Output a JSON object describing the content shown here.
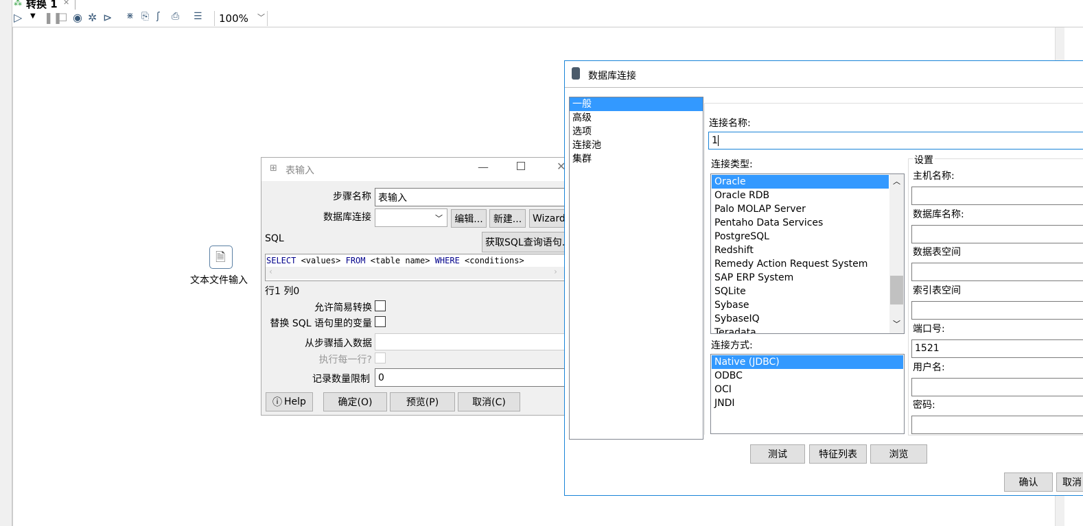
{
  "tab": {
    "title": "转换 1",
    "close": "✕"
  },
  "toolbar": {
    "icons": [
      "run-icon",
      "run-dropdown-icon",
      "pause-icon",
      "stop-icon",
      "preview-icon",
      "debug-icon",
      "replay-icon",
      "verify-icon",
      "impact-icon",
      "sql-icon",
      "explore-db-icon",
      "show-results-icon"
    ],
    "zoom": "100%"
  },
  "canvas": {
    "step_label": "文本文件输入"
  },
  "table_input": {
    "title": "表输入",
    "step_name_label": "步骤名称",
    "step_name_value": "表输入",
    "db_conn_label": "数据库连接",
    "db_conn_value": "",
    "edit": "编辑...",
    "new": "新建...",
    "wizard": "Wizard...",
    "sql_label": "SQL",
    "get_sql": "获取SQL查询语句...",
    "sql": {
      "kw1": "SELECT",
      "t1": " <values> ",
      "kw2": "FROM",
      "t2": " <table name> ",
      "kw3": "WHERE",
      "t3": " <conditions>"
    },
    "position": "行1 列0",
    "lazy_conv": "允许简易转换",
    "replace_vars": "替换 SQL 语句里的变量",
    "insert_from_step": "从步骤插入数据",
    "exec_each_row": "执行每一行?",
    "limit_label": "记录数量限制",
    "limit_value": "0",
    "help": "Help",
    "ok": "确定(O)",
    "preview": "预览(P)",
    "cancel": "取消(C)"
  },
  "db_dialog": {
    "title": "数据库连接",
    "nav": [
      "一般",
      "高级",
      "选项",
      "连接池",
      "集群"
    ],
    "conn_name_label": "连接名称:",
    "conn_name_value": "1",
    "conn_type_label": "连接类型:",
    "conn_types": [
      "Oracle",
      "Oracle RDB",
      "Palo MOLAP Server",
      "Pentaho Data Services",
      "PostgreSQL",
      "Redshift",
      "Remedy Action Request System",
      "SAP ERP System",
      "SQLite",
      "Sybase",
      "SybaseIQ",
      "Teradata"
    ],
    "access_label": "连接方式:",
    "access_types": [
      "Native (JDBC)",
      "ODBC",
      "OCI",
      "JNDI"
    ],
    "settings_label": "设置",
    "fields": [
      {
        "label": "主机名称:",
        "value": ""
      },
      {
        "label": "数据库名称:",
        "value": ""
      },
      {
        "label": "数据表空间",
        "value": ""
      },
      {
        "label": "索引表空间",
        "value": ""
      },
      {
        "label": "端口号:",
        "value": "1521"
      },
      {
        "label": "用户名:",
        "value": ""
      },
      {
        "label": "密码:",
        "value": ""
      }
    ],
    "test": "测试",
    "features": "特征列表",
    "explore": "浏览",
    "ok": "确认",
    "cancel": "取消"
  },
  "colors": {
    "selection": "#3399ff",
    "sql_keyword": "#00008b",
    "dialog_border": "#1883d7"
  }
}
